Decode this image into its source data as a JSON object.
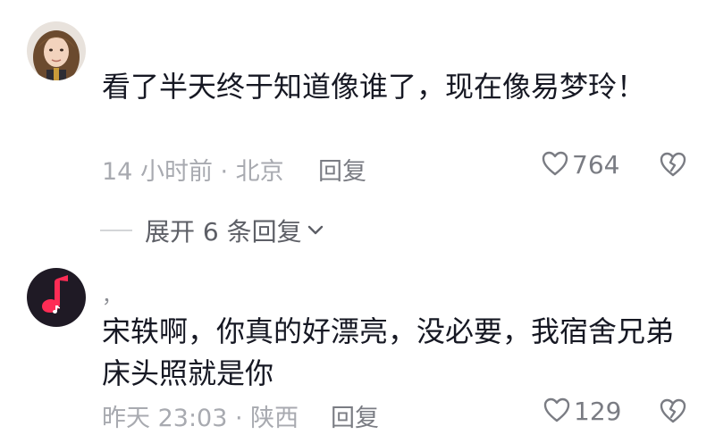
{
  "comments": [
    {
      "username": "",
      "text": "看了半天终于知道像谁了，现在像易梦玲！",
      "time_location": "14 小时前 · 北京",
      "reply_label": "回复",
      "likes": "764"
    },
    {
      "username": "，",
      "text": "宋轶啊，你真的好漂亮，没必要，我宿舍兄弟床头照就是你",
      "time_location": "昨天 23:03 · 陕西",
      "reply_label": "回复",
      "likes": "129"
    }
  ],
  "expand_replies": {
    "label": "展开 6 条回复"
  },
  "colors": {
    "text": "#161823",
    "meta": "#a8aab0",
    "secondary": "#7a7c83",
    "music_avatar_bg": "#1f1a25",
    "music_note": "#fe2c55"
  },
  "icons": {
    "like": "heart-outline-icon",
    "dislike": "broken-heart-icon",
    "expand": "chevron-down-icon"
  }
}
